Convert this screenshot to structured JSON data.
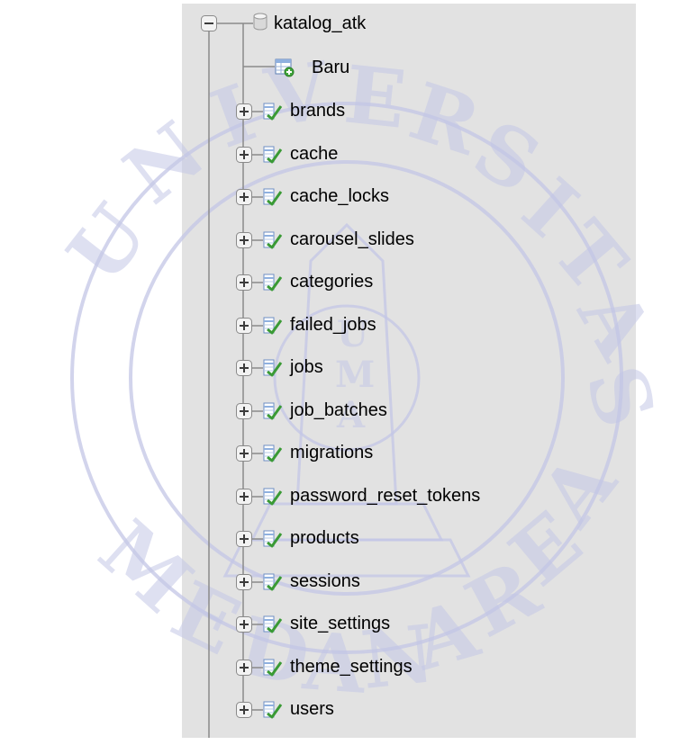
{
  "database": {
    "name": "katalog_atk",
    "icon": "database-icon",
    "expanded": true
  },
  "new_table": {
    "label": "Baru",
    "icon": "new-table-icon"
  },
  "tables": [
    "brands",
    "cache",
    "cache_locks",
    "carousel_slides",
    "categories",
    "failed_jobs",
    "jobs",
    "job_batches",
    "migrations",
    "password_reset_tokens",
    "products",
    "sessions",
    "site_settings",
    "theme_settings",
    "users"
  ],
  "table_icon": "table-structure-icon",
  "expand_icon": "plus-expander-icon",
  "collapse_icon": "minus-expander-icon",
  "colors": {
    "panel_bg": "#e2e2e2",
    "tree_line": "#8a8a8a",
    "watermark": "#b9bde0"
  }
}
